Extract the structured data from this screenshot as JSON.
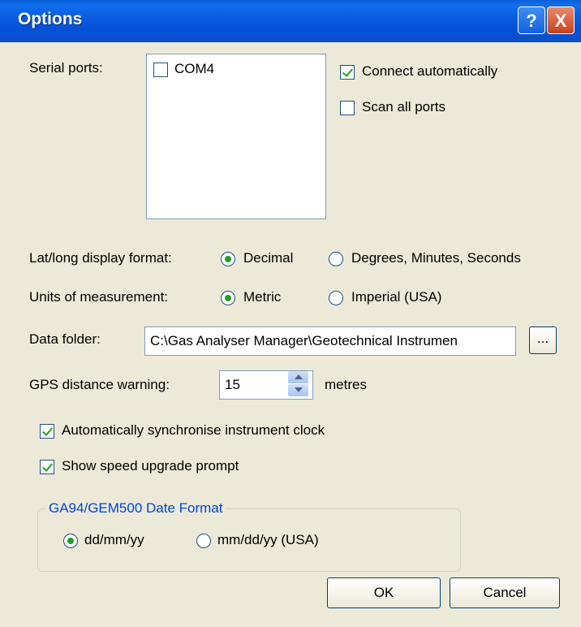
{
  "window": {
    "title": "Options"
  },
  "titlebar": {
    "help_label": "?",
    "close_label": "X"
  },
  "serial_ports": {
    "label": "Serial ports:",
    "items": [
      {
        "label": "COM4",
        "checked": false
      }
    ],
    "connect_automatically": {
      "label": "Connect automatically",
      "checked": true
    },
    "scan_all_ports": {
      "label": "Scan all ports",
      "checked": false
    }
  },
  "latlong": {
    "label": "Lat/long display format:",
    "options": [
      {
        "label": "Decimal",
        "selected": true
      },
      {
        "label": "Degrees, Minutes, Seconds",
        "selected": false
      }
    ]
  },
  "units": {
    "label": "Units of measurement:",
    "options": [
      {
        "label": "Metric",
        "selected": true
      },
      {
        "label": "Imperial (USA)",
        "selected": false
      }
    ]
  },
  "data_folder": {
    "label": "Data folder:",
    "value": "C:\\Gas Analyser Manager\\Geotechnical Instrumen",
    "browse_label": "..."
  },
  "gps_warning": {
    "label": "GPS distance warning:",
    "value": "15",
    "units": "metres"
  },
  "sync_clock": {
    "label": "Automatically synchronise instrument clock",
    "checked": true
  },
  "speed_prompt": {
    "label": "Show speed upgrade prompt",
    "checked": true
  },
  "date_format": {
    "title": "GA94/GEM500 Date Format",
    "options": [
      {
        "label": "dd/mm/yy",
        "selected": true
      },
      {
        "label": "mm/dd/yy (USA)",
        "selected": false
      }
    ]
  },
  "buttons": {
    "ok": "OK",
    "cancel": "Cancel"
  }
}
